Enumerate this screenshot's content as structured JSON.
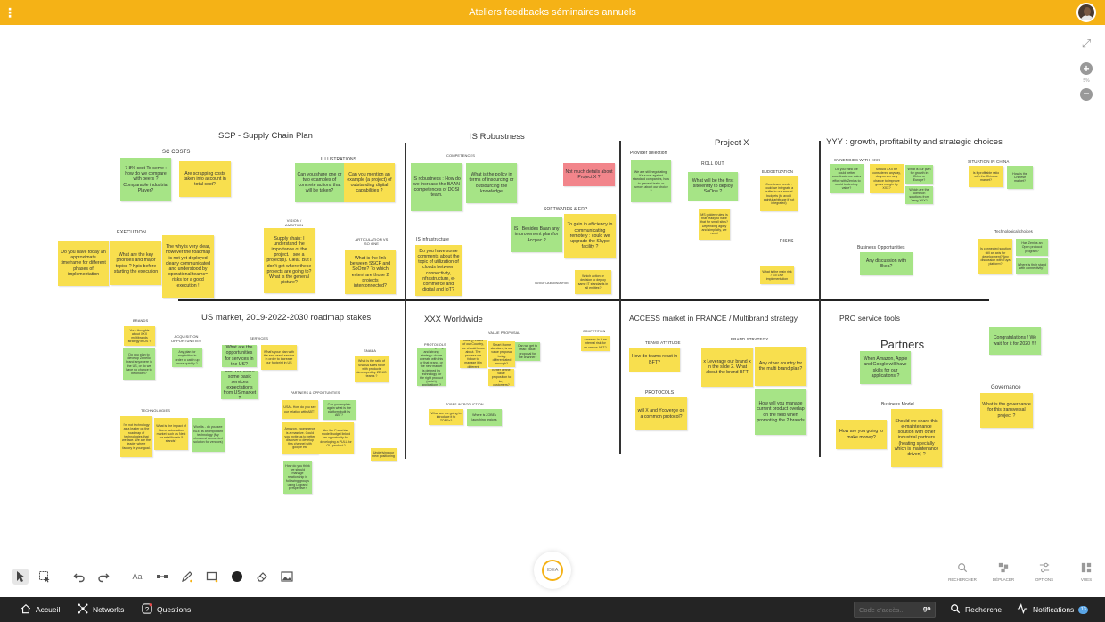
{
  "app": {
    "title": "Ateliers feedbacks séminaires annuels",
    "zoom_level": "5%",
    "menu_glyph": "⋮"
  },
  "board": {
    "sections": [
      {
        "id": "scp",
        "title": "SCP -  Supply Chain Plan"
      },
      {
        "id": "isr",
        "title": "IS Robustness"
      },
      {
        "id": "px",
        "title": "Project X"
      },
      {
        "id": "yyy",
        "title": "YYY : growth, profitability and strategic choices"
      },
      {
        "id": "us",
        "title": "US market, 2019-2022-2030 roadmap stakes"
      },
      {
        "id": "xxx",
        "title": "XXX Worldwide"
      },
      {
        "id": "access",
        "title": "ACCESS market in FRANCE / Multibrand strategy"
      },
      {
        "id": "pro",
        "title": "PRO service tools"
      },
      {
        "id": "partners",
        "title": "Partners"
      }
    ],
    "labels": [
      "SC COSTS",
      "ILLUSTRATIONS",
      "EXECUTION",
      "VISION / AMBITION",
      "ARTICULATION VS SO ONE",
      "COMPETENCES",
      "SOFTWARES & ERP",
      "IS infrastructure",
      "GROUP HARMONIZATION",
      "Provider selection",
      "ROLL OUT",
      "BUDGETIZATION",
      "RISKS",
      "SYNERGIES WITH XXX",
      "SITUATION IN CHINA",
      "Technological choices",
      "Business Opportunities",
      "BRANDS",
      "ACQUISITION OPPORTUNITIES",
      "SERVICES",
      "SNABA",
      "PARTNERS & OPPORTUNITIES",
      "TECHNOLOGIES",
      "PROTOCOLS",
      "VALUE PROPOSAL",
      "COMPETITION",
      "ZOBES INTRODUCTION",
      "TEAMS ATTITUDE",
      "BRAND STRATEGY",
      "PROTOCOLS",
      "Business Model",
      "Governance"
    ],
    "notes": [
      {
        "text": "7 8% cost To serve : how do we compare with peers ? Comparable industrial Player?",
        "color": "green"
      },
      {
        "text": "Are scrapping costs taken into account in total cost?",
        "color": "yellow"
      },
      {
        "text": "Can you share one or two examples of concrete actions that will be taken?",
        "color": "green"
      },
      {
        "text": "Can you mention an example (a project) of outstanding digital capabilities ?",
        "color": "yellow"
      },
      {
        "text": "Do you have today an approximate timeframe for different phases of implementation",
        "color": "yellow"
      },
      {
        "text": "What are the key priorities and major topics ? Kpis before starting the execution",
        "color": "yellow"
      },
      {
        "text": "The why is very clear, however the roadmap is not yet deployed clearly communicated and understood by operational teams= risks for a good execution !",
        "color": "yellow"
      },
      {
        "text": "Supply chain: I understand the importance of the project. I see a project(s). Clear. But I don't get where these projects are going to? What is the general picture?",
        "color": "yellow"
      },
      {
        "text": "What is the link between SSCP and SoOne? To which extent are those 2 projects interconnected?",
        "color": "yellow"
      },
      {
        "text": "IS robustness : How do we increase the BAAN competences of DOSI team.",
        "color": "green"
      },
      {
        "text": "What is the policy in terms of insourcing or outsourcing the knowledge",
        "color": "green"
      },
      {
        "text": "Not much details about Project X ?",
        "color": "red"
      },
      {
        "text": "IS : Besides Baan any improvement plan for Accpac ?",
        "color": "green"
      },
      {
        "text": "To gain in efficiency in communicating remotely : could we upgrade the Skype facility ?",
        "color": "yellow"
      },
      {
        "text": "Do you have some comments about the topic of utilization of clouds between connectivity, infrastructure, e-commerce and digital and IoT?",
        "color": "yellow"
      },
      {
        "text": "Which action or decision to deploy same IT standards in all entities?",
        "color": "yellow"
      },
      {
        "text": "We are still negotiating. It's a war against standard companies, how to prevent leaks or rumors about our choice ?",
        "color": "green"
      },
      {
        "text": "What will be the first site/entity to deploy SoOne ?",
        "color": "green"
      },
      {
        "text": "Core team needs : could we integrate a buffer in our annual budgets (to avoid painful arbitrage if not integrated)",
        "color": "yellow"
      },
      {
        "text": "MS golden rules: is that ready to have that for small sites? Depending agility and simplicity, we need",
        "color": "yellow"
      },
      {
        "text": "What is the main risk / Go Live implementation",
        "color": "yellow"
      },
      {
        "text": "Do you think we could better coordinate our sales effort with Zenius to avoid to destroy value?",
        "color": "green"
      },
      {
        "text": "Should XXX be considered anyway, do you see any chance to improve gross margin by XXX?",
        "color": "yellow"
      },
      {
        "text": "What is our plan for growth in China or Europe?",
        "color": "green"
      },
      {
        "text": "Which are the common solutions from Yang XXX?",
        "color": "green"
      },
      {
        "text": "Is it profitable ratio with the Chinese market?",
        "color": "yellow"
      },
      {
        "text": "How is the Chinese market?",
        "color": "green"
      },
      {
        "text": "Any discussion with Ilkea?",
        "color": "green"
      },
      {
        "text": "Is connected solution still an axis for development? Any discussion with Tuya platform?",
        "color": "yellow"
      },
      {
        "text": "Has Zenius an Open protocol program?",
        "color": "green"
      },
      {
        "text": "Where is their stand with connectivity?",
        "color": "green"
      },
      {
        "text": "Your thoughts about XXX multibrands strategy in US ?",
        "color": "yellow"
      },
      {
        "text": "Do you plan to develop Zenello brand anywhere in the US, or do we have no chance to be known?",
        "color": "green"
      },
      {
        "text": "Any plan for acquisition in order to catch up more quickly ?",
        "color": "green"
      },
      {
        "text": "What are the opportunities for services in the US?",
        "color": "green"
      },
      {
        "text": "What's your plan with the end user / service in order to increase our footprint in US",
        "color": "yellow"
      },
      {
        "text": "Can you share some basic services expectations from US market ?",
        "color": "green"
      },
      {
        "text": "What is the ratio of SNABA sales force with products developed by ZENIO teams ?",
        "color": "yellow"
      },
      {
        "text": "USA - How do you see our relation with ABT?",
        "color": "yellow"
      },
      {
        "text": "Can you explain again what is the platform built by ABT?",
        "color": "green"
      },
      {
        "text": "Amazon, ecommerce is a massive. Could you invite us to better discover to develop this channel with google etc",
        "color": "yellow"
      },
      {
        "text": "Are the Franchise model budget linked an opportunity for developing a PULL for OU product ?",
        "color": "yellow"
      },
      {
        "text": "How do you think we should manage relationship in following groups using Legrand perspective?",
        "color": "green"
      },
      {
        "text": "Underlying our new positioning",
        "color": "yellow"
      },
      {
        "text": "I'm not technology as a leader on the roadmap of technologies that we face. We are the leader where factory is your goal.",
        "color": "yellow"
      },
      {
        "text": "What is the impact of Home automation market such as Nest for retail/hotels 5 stands?",
        "color": "yellow"
      },
      {
        "text": "Worlds - do you see BLE as an important technology (My cheapest connected solution for vendors)",
        "color": "green"
      },
      {
        "text": "Considering long and strong strategy: do we operate with this or that brand, or the new market is defined by technology for the right product (which) applications ?",
        "color": "green"
      },
      {
        "text": "Interesting and stating results of our Country, we should know about. The process we follow to manage it in different country?",
        "color": "yellow"
      },
      {
        "text": "Smart Home standard, is our value proposal being differentiated enough?",
        "color": "yellow"
      },
      {
        "text": "Can we get to retail: value-proposal for the channel?",
        "color": "green"
      },
      {
        "text": "Better define value proposition to key customers?",
        "color": "yellow"
      },
      {
        "text": "Amazon: is it an internal risk for us versus ABT?",
        "color": "yellow"
      },
      {
        "text": "What are we going to introduce it to ZOBEs?",
        "color": "yellow"
      },
      {
        "text": "Where is ZOBEs launching regions",
        "color": "green"
      },
      {
        "text": "How do teams react in BFT?",
        "color": "yellow"
      },
      {
        "text": "x Leverage our brand x in the slide 2. What about the brand BFT",
        "color": "yellow"
      },
      {
        "text": "Any other country for the multi brand plan?",
        "color": "yellow"
      },
      {
        "text": "will X and Ycoverge on a common protocol?",
        "color": "yellow"
      },
      {
        "text": "How will you manage current product overlap on the field when promoting the 2 brands",
        "color": "green"
      },
      {
        "text": "When Amazon, Apple and Google will have skills for our applications ?",
        "color": "green"
      },
      {
        "text": "Congratulations ! We wait for it for 2020 !!!!",
        "color": "green"
      },
      {
        "text": "How are you going to make money?",
        "color": "yellow"
      },
      {
        "text": "Should we share this e-maintenance solution with other industrial partners (heating specially which is maintenance driven) ?",
        "color": "yellow"
      },
      {
        "text": "What is the governance for this transversal project ?",
        "color": "yellow"
      }
    ]
  },
  "toolbar": {
    "tools": [
      "pointer-icon",
      "multi-select-icon",
      "undo-icon",
      "redo-icon",
      "text-icon",
      "connector-icon",
      "pen-icon",
      "rectangle-icon",
      "color-dot-icon",
      "eraser-icon",
      "image-icon"
    ],
    "text_tool_label": "Aa",
    "idea_label": "IDEA",
    "right_tools": [
      {
        "icon": "search-icon",
        "label": "RECHERCHER"
      },
      {
        "icon": "move-icon",
        "label": "DÉPLACER"
      },
      {
        "icon": "options-icon",
        "label": "OPTIONS"
      },
      {
        "icon": "views-icon",
        "label": "VUES"
      }
    ]
  },
  "footer": {
    "home": "Accueil",
    "networks": "Networks",
    "questions": "Questions",
    "access_code_placeholder": "Code d'accès...",
    "go": "go",
    "search": "Recherche",
    "notifications": "Notifications",
    "notifications_count": "13"
  },
  "colors": {
    "accent": "#f5b216",
    "note_yellow": "#f8df4e",
    "note_green": "#a6e486",
    "note_red": "#f2858b",
    "footer_bg": "#242424",
    "badge": "#5aa5e6"
  }
}
